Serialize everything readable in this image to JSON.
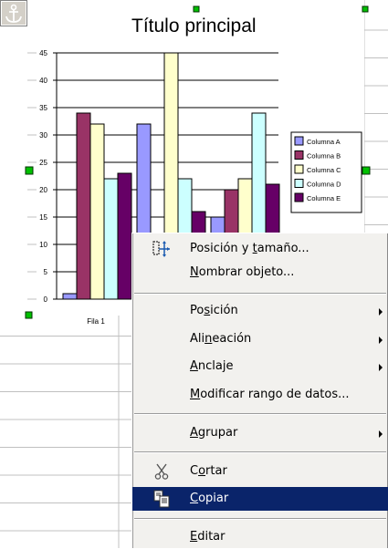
{
  "chart": {
    "title": "Título principal",
    "y_ticks": [
      "0",
      "5",
      "10",
      "15",
      "20",
      "25",
      "30",
      "35",
      "40",
      "45"
    ],
    "category_visible_label": "Fila 1"
  },
  "chart_data": {
    "type": "bar",
    "title": "Título principal",
    "categories": [
      "Fila 1",
      "",
      ""
    ],
    "ylim": [
      0,
      45
    ],
    "grid": true,
    "legend_position": "right",
    "series": [
      {
        "name": "Columna A",
        "color": "#9999ff",
        "values": [
          1,
          32,
          15
        ]
      },
      {
        "name": "Columna B",
        "color": "#993366",
        "values": [
          34,
          null,
          20
        ]
      },
      {
        "name": "Columna C",
        "color": "#ffffcc",
        "values": [
          32,
          45,
          22
        ]
      },
      {
        "name": "Columna D",
        "color": "#ccffff",
        "values": [
          22,
          22,
          34
        ]
      },
      {
        "name": "Columna E",
        "color": "#660066",
        "values": [
          23,
          16,
          21
        ]
      }
    ]
  },
  "menu": {
    "items": [
      {
        "id": "posicion-tamano",
        "pre": "Posición y ",
        "acc": "t",
        "post": "amaño...",
        "icon": "position-size-icon"
      },
      {
        "id": "nombrar-objeto",
        "pre": "",
        "acc": "N",
        "post": "ombrar objeto..."
      },
      {
        "id": "posicion",
        "pre": "Po",
        "acc": "s",
        "post": "ición",
        "submenu": true
      },
      {
        "id": "alineacion",
        "pre": "Ali",
        "acc": "n",
        "post": "eación",
        "submenu": true
      },
      {
        "id": "anclaje",
        "pre": "",
        "acc": "A",
        "post": "nclaje",
        "submenu": true
      },
      {
        "id": "modificar-rango",
        "pre": "",
        "acc": "M",
        "post": "odificar rango de datos..."
      },
      {
        "id": "agrupar",
        "pre": "",
        "acc": "A",
        "post": "grupar",
        "submenu": true
      },
      {
        "id": "cortar",
        "pre": "C",
        "acc": "o",
        "post": "rtar",
        "icon": "scissors-icon"
      },
      {
        "id": "copiar",
        "pre": "",
        "acc": "C",
        "post": "opiar",
        "icon": "copy-icon",
        "selected": true
      },
      {
        "id": "editar",
        "pre": "",
        "acc": "E",
        "post": "ditar"
      }
    ]
  },
  "colors": {
    "menu_highlight": "#0a246a",
    "selection_handle": "#00c000",
    "menu_background": "#f2f1ee"
  },
  "icons": {
    "anchor": "anchor-icon"
  }
}
